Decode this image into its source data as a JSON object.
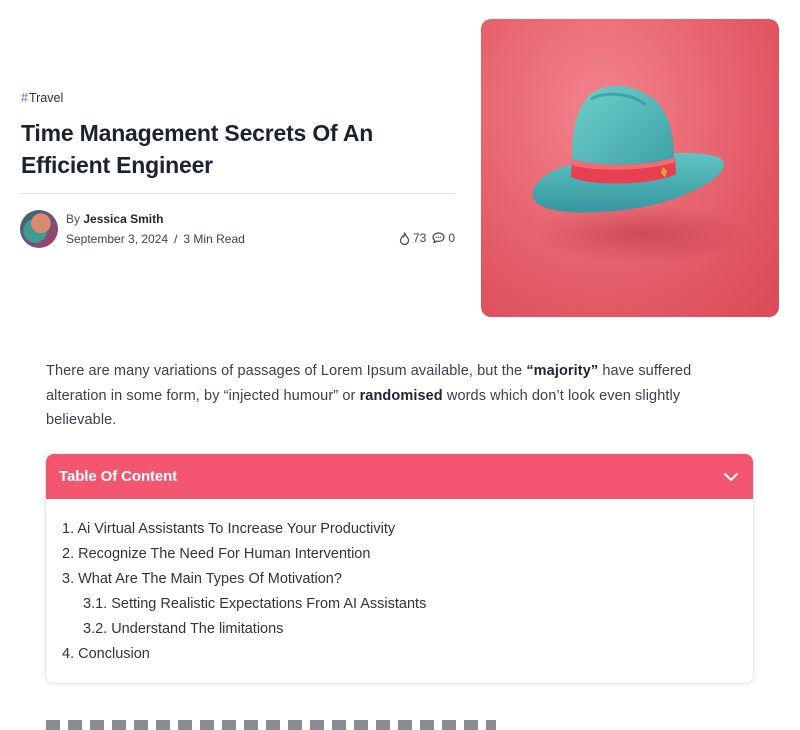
{
  "post": {
    "tag_hash": "#",
    "tag": "Travel",
    "title": "Time Management Secrets Of An Efficient Engineer",
    "by_prefix": "By",
    "author": "Jessica Smith",
    "date": "September 3, 2024",
    "separator": "/",
    "read_time": "3 Min Read",
    "views": "73",
    "comments": "0"
  },
  "intro": {
    "part1": "There are many variations of passages of Lorem Ipsum available, but the ",
    "bold1": "“majority”",
    "part2": " have suffered alteration in some form, by “injected humour” or ",
    "bold2": "randomised",
    "part3": " words which don’t look even slightly believable."
  },
  "toc": {
    "title": "Table Of Content",
    "items": [
      "1. Ai Virtual Assistants To Increase Your Productivity",
      "2. Recognize The Need For Human Intervention",
      "3. What Are The Main Types Of Motivation?",
      "3.1. Setting Realistic Expectations From AI Assistants",
      "3.2. Understand The limitations",
      "4. Conclusion"
    ]
  },
  "colors": {
    "accent": "#f4566f",
    "tag_hash": "#6d5cd6",
    "hero_bg": "#e25764",
    "hat": "#4fb8b8",
    "hat_band": "#e8404f"
  },
  "icons": [
    "views-icon",
    "comment-icon",
    "chevron-down-icon"
  ]
}
